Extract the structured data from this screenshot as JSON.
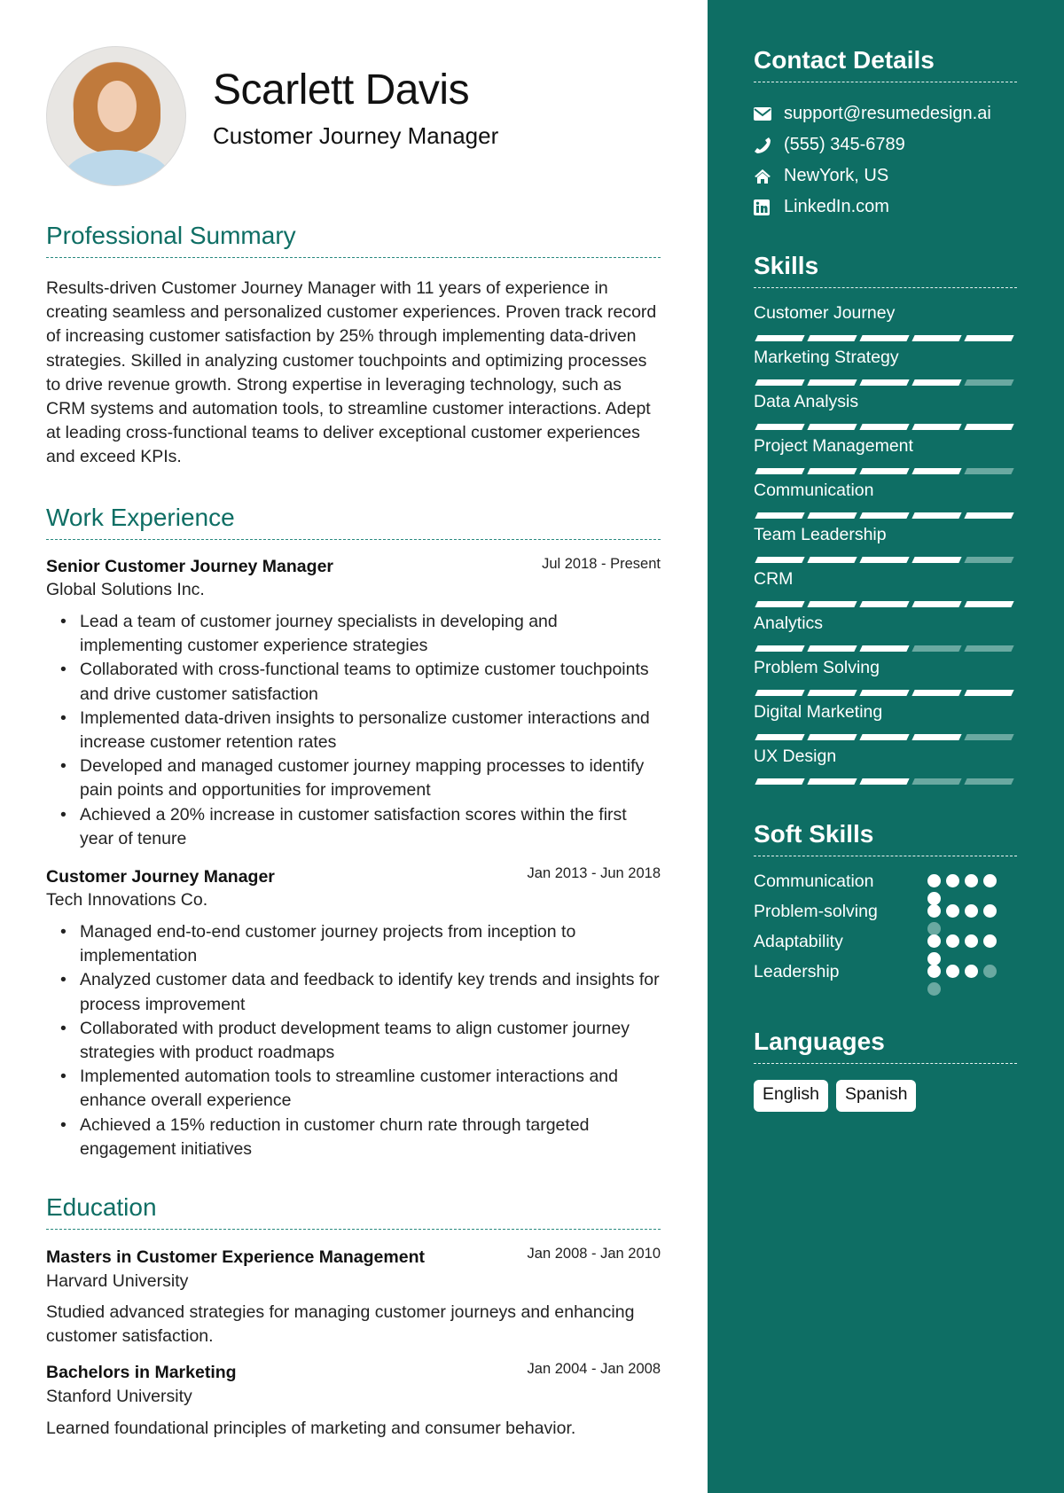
{
  "header": {
    "name": "Scarlett Davis",
    "title": "Customer Journey Manager"
  },
  "summary": {
    "heading": "Professional Summary",
    "text": "Results-driven Customer Journey Manager with 11 years of experience in creating seamless and personalized customer experiences. Proven track record of increasing customer satisfaction by 25% through implementing data-driven strategies. Skilled in analyzing customer touchpoints and optimizing processes to drive revenue growth. Strong expertise in leveraging technology, such as CRM systems and automation tools, to streamline customer interactions. Adept at leading cross-functional teams to deliver exceptional customer experiences and exceed KPIs."
  },
  "experience": {
    "heading": "Work Experience",
    "jobs": [
      {
        "title": "Senior Customer Journey Manager",
        "company": "Global Solutions Inc.",
        "dates": "Jul 2018 - Present",
        "bullets": [
          "Lead a team of customer journey specialists in developing and implementing customer experience strategies",
          "Collaborated with cross-functional teams to optimize customer touchpoints and drive customer satisfaction",
          "Implemented data-driven insights to personalize customer interactions and increase customer retention rates",
          "Developed and managed customer journey mapping processes to identify pain points and opportunities for improvement",
          "Achieved a 20% increase in customer satisfaction scores within the first year of tenure"
        ]
      },
      {
        "title": "Customer Journey Manager",
        "company": "Tech Innovations Co.",
        "dates": "Jan 2013 - Jun 2018",
        "bullets": [
          "Managed end-to-end customer journey projects from inception to implementation",
          "Analyzed customer data and feedback to identify key trends and insights for process improvement",
          "Collaborated with product development teams to align customer journey strategies with product roadmaps",
          "Implemented automation tools to streamline customer interactions and enhance overall experience",
          "Achieved a 15% reduction in customer churn rate through targeted engagement initiatives"
        ]
      }
    ]
  },
  "education": {
    "heading": "Education",
    "items": [
      {
        "degree": "Masters in Customer Experience Management",
        "school": "Harvard University",
        "dates": "Jan 2008 - Jan 2010",
        "description": "Studied advanced strategies for managing customer journeys and enhancing customer satisfaction."
      },
      {
        "degree": "Bachelors in Marketing",
        "school": "Stanford University",
        "dates": "Jan 2004 - Jan 2008",
        "description": "Learned foundational principles of marketing and consumer behavior."
      }
    ]
  },
  "sidebar": {
    "contact": {
      "heading": "Contact Details",
      "items": [
        {
          "icon": "envelope-icon",
          "text": "support@resumedesign.ai"
        },
        {
          "icon": "phone-icon",
          "text": "(555) 345-6789"
        },
        {
          "icon": "home-icon",
          "text": "NewYork, US"
        },
        {
          "icon": "linkedin-icon",
          "text": "LinkedIn.com"
        }
      ]
    },
    "skills": {
      "heading": "Skills",
      "max_level": 5,
      "items": [
        {
          "name": "Customer Journey",
          "level": 5
        },
        {
          "name": "Marketing Strategy",
          "level": 4
        },
        {
          "name": "Data Analysis",
          "level": 5
        },
        {
          "name": "Project Management",
          "level": 4
        },
        {
          "name": "Communication",
          "level": 5
        },
        {
          "name": "Team Leadership",
          "level": 4
        },
        {
          "name": "CRM",
          "level": 5
        },
        {
          "name": "Analytics",
          "level": 3
        },
        {
          "name": "Problem Solving",
          "level": 5
        },
        {
          "name": "Digital Marketing",
          "level": 4
        },
        {
          "name": "UX Design",
          "level": 3
        }
      ]
    },
    "soft_skills": {
      "heading": "Soft Skills",
      "max_level": 5,
      "items": [
        {
          "name": "Communication",
          "level": 5
        },
        {
          "name": "Problem-solving",
          "level": 4
        },
        {
          "name": "Adaptability",
          "level": 5
        },
        {
          "name": "Leadership",
          "level": 3
        }
      ]
    },
    "languages": {
      "heading": "Languages",
      "items": [
        "English",
        "Spanish"
      ]
    }
  },
  "colors": {
    "accent": "#0e6e64",
    "bar_inactive": "#6aa9a1"
  }
}
